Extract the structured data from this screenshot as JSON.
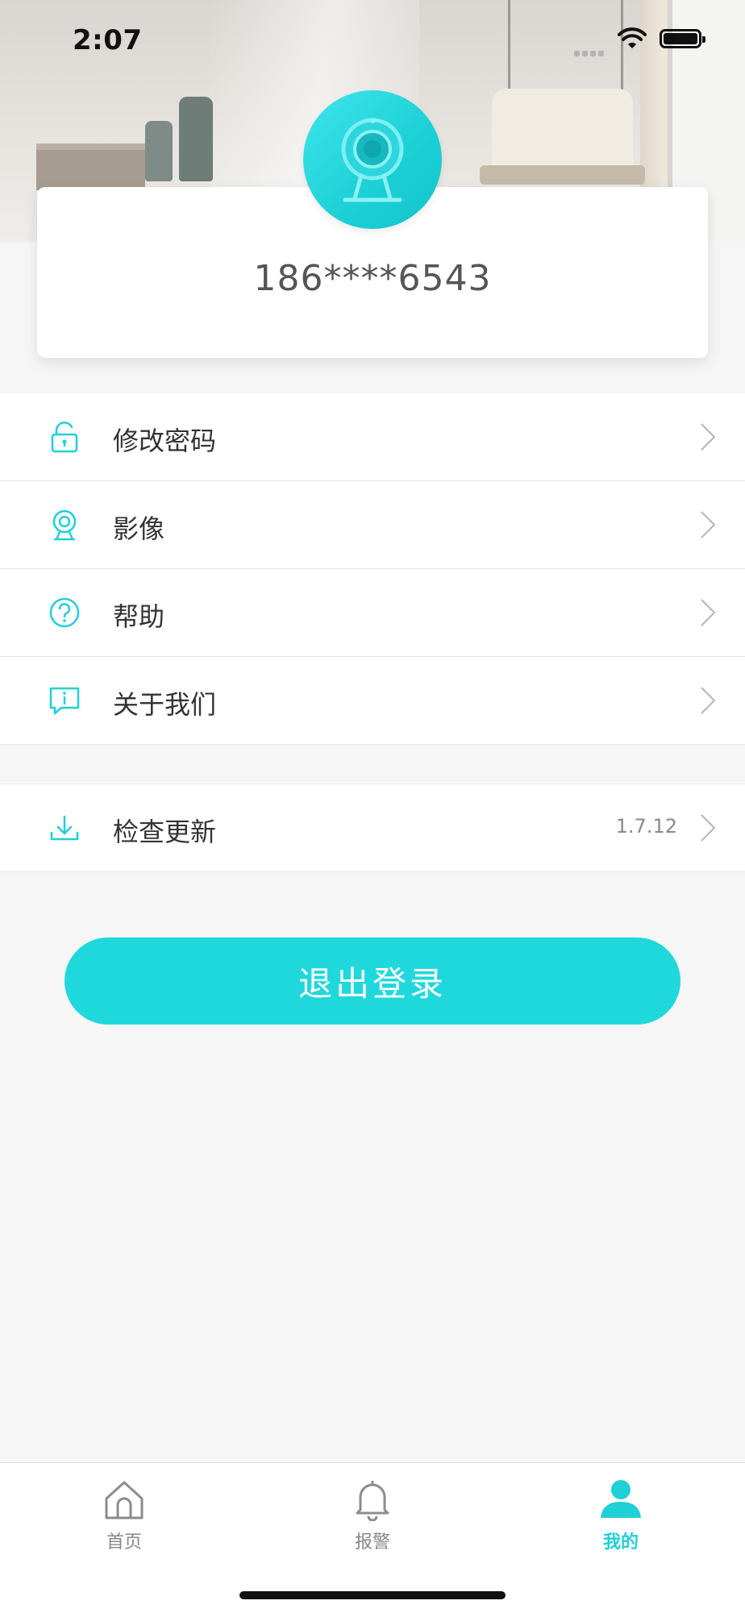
{
  "status_bar": {
    "time": "2:07"
  },
  "profile": {
    "phone": "186****6543",
    "avatar_icon": "camera-icon"
  },
  "menu": [
    {
      "label": "修改密码",
      "icon": "lock-icon"
    },
    {
      "label": "影像",
      "icon": "camera-icon"
    },
    {
      "label": "帮助",
      "icon": "question-circle-icon"
    },
    {
      "label": "关于我们",
      "icon": "info-message-icon"
    }
  ],
  "update": {
    "label": "检查更新",
    "version": "1.7.12",
    "icon": "download-icon"
  },
  "logout_label": "退出登录",
  "tabs": [
    {
      "label": "首页",
      "icon": "home-icon",
      "active": false
    },
    {
      "label": "报警",
      "icon": "bell-icon",
      "active": false
    },
    {
      "label": "我的",
      "icon": "user-icon",
      "active": true
    }
  ],
  "colors": {
    "accent": "#1fd8dc",
    "background": "#f6f6f6",
    "text": "#333333"
  }
}
